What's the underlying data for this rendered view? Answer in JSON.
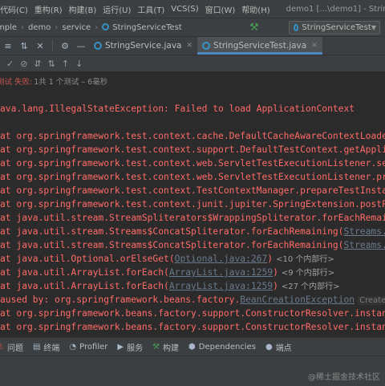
{
  "menu": {
    "items": [
      "代码(C)",
      "重构(R)",
      "构建(B)",
      "运行(U)",
      "工具(T)",
      "VCS(S)",
      "窗口(W)",
      "帮助(H)"
    ],
    "window_title": "demo1 [...\\demo1] - StringServiceTe"
  },
  "nav": {
    "breadcrumbs": [
      "mple",
      "demo",
      "service",
      "StringServiceTest"
    ],
    "run_config": "StringServiceTest"
  },
  "tabs": [
    {
      "label": "StringService.java",
      "active": false
    },
    {
      "label": "StringServiceTest.java",
      "active": true
    }
  ],
  "test_status": {
    "failed_label": "测试 失败:",
    "summary": "1共 1 个测试 – 6毫秒"
  },
  "console": {
    "lines": [
      {
        "kind": "error",
        "text": "ava.lang.IllegalStateException: Failed to load ApplicationContext"
      },
      {
        "kind": "blank",
        "text": ""
      },
      {
        "kind": "frame",
        "text": "    at org.springframework.test.context.cache.DefaultCacheAwareContextLoaderDe"
      },
      {
        "kind": "frame",
        "text": "    at org.springframework.test.context.support.DefaultTestContext.getApplicati"
      },
      {
        "kind": "frame",
        "text": "    at org.springframework.test.context.web.ServletTestExecutionListener.setUpR"
      },
      {
        "kind": "frame",
        "text": "    at org.springframework.test.context.web.ServletTestExecutionListener.prepar"
      },
      {
        "kind": "frame",
        "text": "    at org.springframework.test.context.TestContextManager.prepareTestInstance("
      },
      {
        "kind": "frame",
        "text": "    at org.springframework.test.context.junit.jupiter.SpringExtension.postProce"
      },
      {
        "kind": "frame",
        "text": "    at java.util.stream.StreamSpliterators$WrappingSpliterator.forEachRemaining"
      },
      {
        "kind": "frame_link",
        "text": "    at java.util.stream.Streams$ConcatSpliterator.forEachRemaining(",
        "link": "Streams.java"
      },
      {
        "kind": "frame_link",
        "text": "    at java.util.stream.Streams$ConcatSpliterator.forEachRemaining(",
        "link": "Streams.java"
      },
      {
        "kind": "frame_link_fold",
        "text": "    at java.util.Optional.orElseGet(",
        "link": "Optional.java:267",
        "tail": ")",
        "fold": "<10 个内部行>"
      },
      {
        "kind": "frame_link_fold",
        "text": "    at java.util.ArrayList.forEach(",
        "link": "ArrayList.java:1259",
        "tail": ")",
        "fold": "<9 个内部行>"
      },
      {
        "kind": "frame_link_fold",
        "text": "    at java.util.ArrayList.forEach(",
        "link": "ArrayList.java:1259",
        "tail": ")",
        "fold": "<27 个内部行>"
      },
      {
        "kind": "caused_by",
        "text": "aused by: org.springframework.beans.factory.",
        "link": "BeanCreationException",
        "hint": "Create breakpoi"
      },
      {
        "kind": "frame",
        "text": "    at org.springframework.beans.factory.support.ConstructorResolver.instantia"
      },
      {
        "kind": "frame",
        "text": "    at org.springframework.beans.factory.support.ConstructorResolver.instantia"
      }
    ]
  },
  "bottom_tools": [
    {
      "icon": "problems-icon",
      "glyph": "⚠",
      "label": "问题"
    },
    {
      "icon": "terminal-icon",
      "glyph": "▤",
      "label": "终端"
    },
    {
      "icon": "profiler-icon",
      "glyph": "◔",
      "label": "Profiler"
    },
    {
      "icon": "services-icon",
      "glyph": "▶",
      "label": "服务"
    },
    {
      "icon": "build-icon",
      "glyph": "⚒",
      "label": "构建"
    },
    {
      "icon": "dependencies-icon",
      "glyph": "⬢",
      "label": "Dependencies"
    },
    {
      "icon": "breakpoints-icon",
      "glyph": "●",
      "label": "端点"
    }
  ],
  "watermark": "@稀土掘金技术社区",
  "colors": {
    "error": "#ff6b68",
    "link": "#6a7a8c",
    "accent": "#4a88c7"
  }
}
